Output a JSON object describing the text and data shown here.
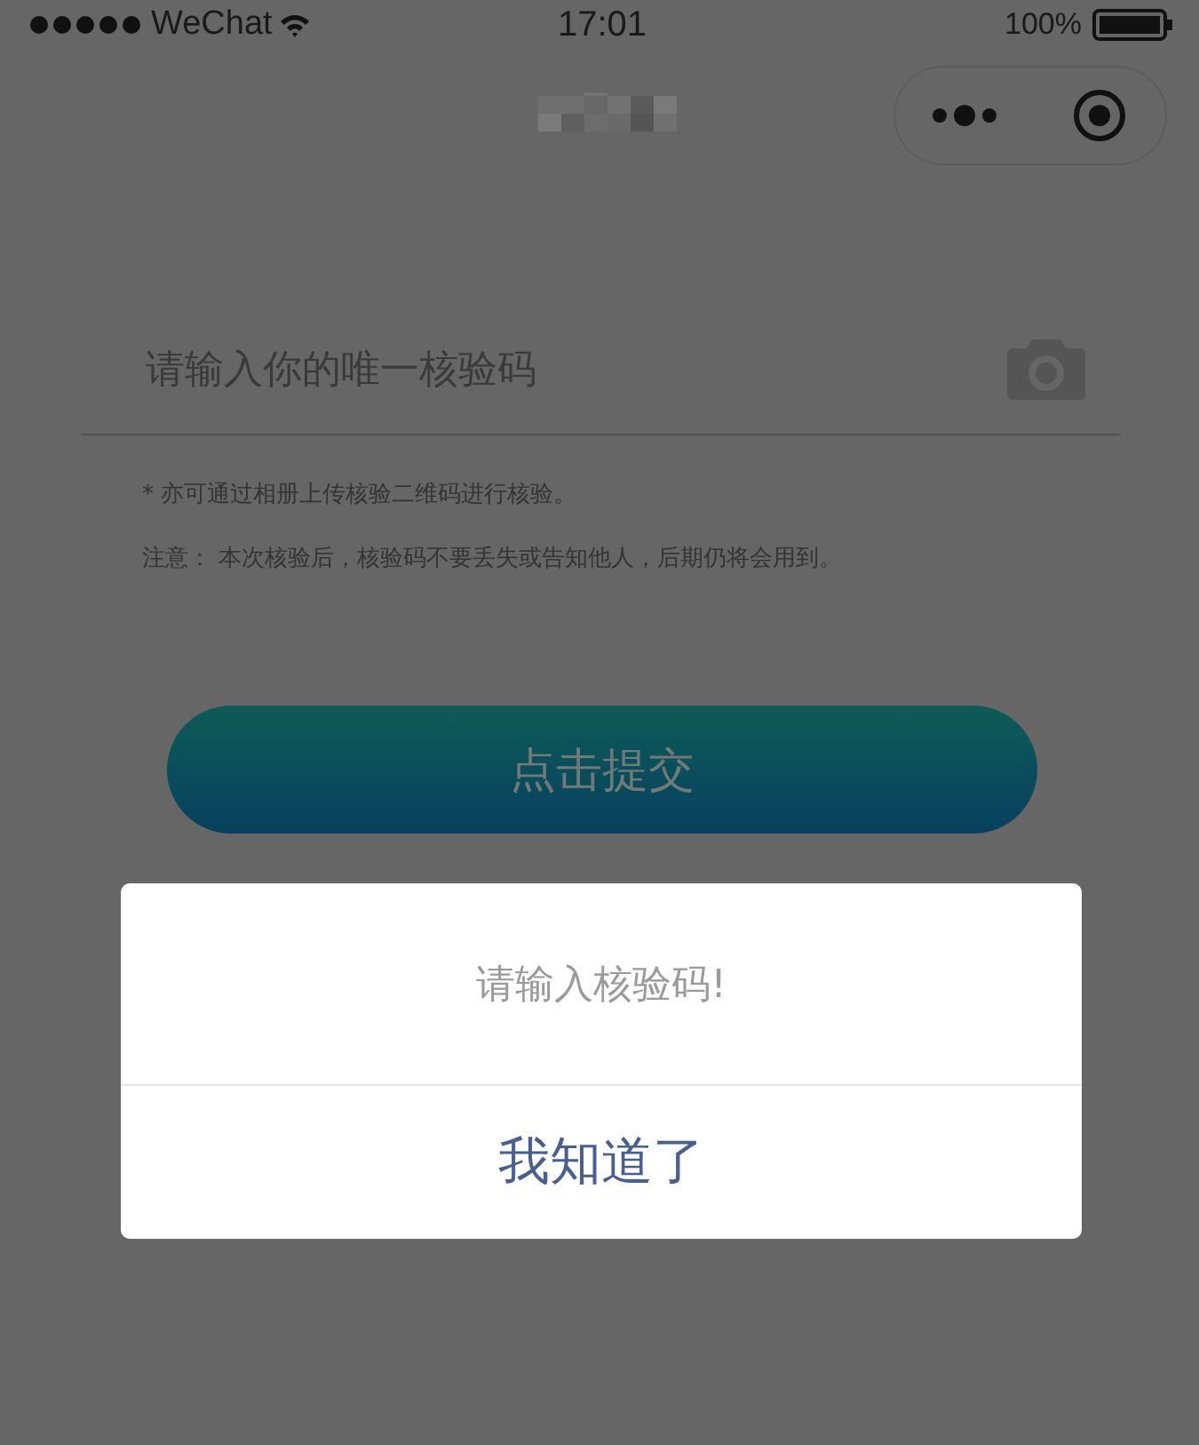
{
  "status_bar": {
    "carrier": "WeChat",
    "time": "17:01",
    "battery": "100%"
  },
  "code_field": {
    "placeholder": "请输入你的唯一核验码"
  },
  "notes": [
    "* 亦可通过相册上传核验二维码进行核验。",
    "注意： 本次核验后，核验码不要丢失或告知他人，后期仍将会用到。"
  ],
  "submit_button": "点击提交",
  "dialog": {
    "message": "请输入核验码!",
    "confirm": "我知道了"
  }
}
